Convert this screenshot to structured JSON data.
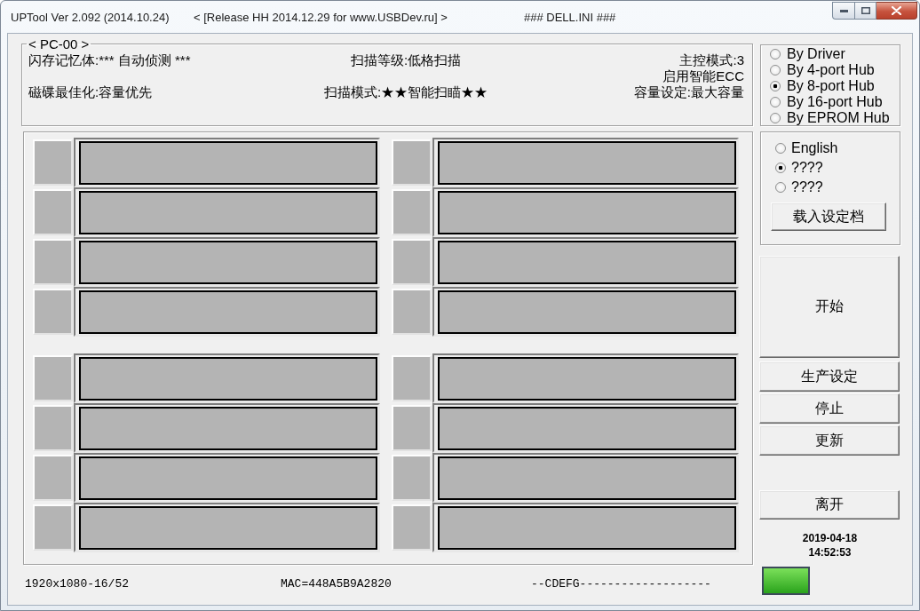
{
  "window": {
    "title": "UPTool Ver 2.092 (2014.10.24)",
    "release": "< [Release HH 2014.12.29 for www.USBDev.ru] >",
    "config_file": "### DELL.INI ###"
  },
  "info_panel": {
    "legend": "< PC-00 >",
    "left": [
      "闪存记忆体:*** 自动侦测 ***",
      "磁碟最佳化:容量优先"
    ],
    "center": [
      "扫描等级:低格扫描",
      "扫描模式:★★智能扫瞄★★"
    ],
    "right": [
      "主控模式:3",
      "启用智能ECC",
      "容量设定:最大容量"
    ]
  },
  "status_bar": {
    "resolution": "1920x1080-16/52",
    "mac": "MAC=448A5B9A2820",
    "drives": "--CDEFG-------------------"
  },
  "hub_mode": {
    "options": [
      {
        "label": "By Driver",
        "selected": false
      },
      {
        "label": "By 4-port Hub",
        "selected": false
      },
      {
        "label": "By 8-port Hub",
        "selected": true
      },
      {
        "label": "By 16-port Hub",
        "selected": false
      },
      {
        "label": "By EPROM Hub",
        "selected": false
      }
    ]
  },
  "language": {
    "options": [
      {
        "label": "English",
        "selected": false
      },
      {
        "label": "????",
        "selected": true
      },
      {
        "label": "????",
        "selected": false
      }
    ],
    "load_button": "载入设定档"
  },
  "start_button": "开始",
  "buttons": [
    "生产设定",
    "停止",
    "更新"
  ],
  "exit_button": "离开",
  "clock": {
    "date": "2019-04-18",
    "time": "14:52:53"
  }
}
